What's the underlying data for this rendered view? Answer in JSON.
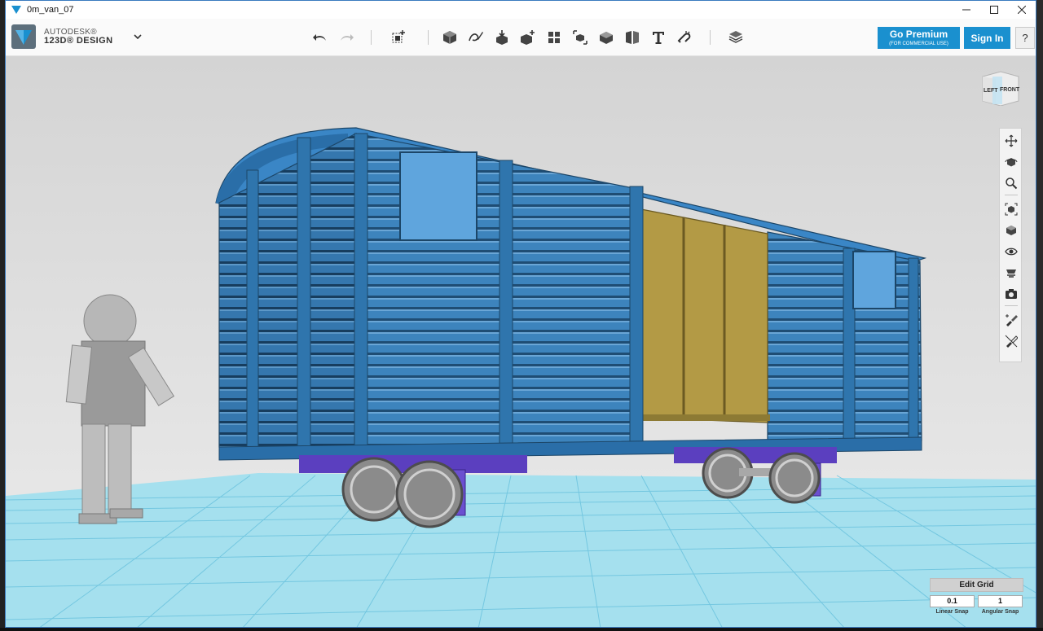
{
  "window": {
    "title": "0m_van_07"
  },
  "app": {
    "brand_line1": "AUTODESK®",
    "brand_line2": "123D® DESIGN"
  },
  "toolbar": {
    "premium_label": "Go Premium",
    "premium_sub": "(FOR COMMERCIAL USE)",
    "signin_label": "Sign In",
    "help_label": "?"
  },
  "viewcube": {
    "left_label": "LEFT",
    "front_label": "FRONT"
  },
  "grid": {
    "edit_label": "Edit Grid",
    "linear_snap_value": "0.1",
    "angular_snap_value": "1",
    "linear_snap_label": "Linear Snap",
    "angular_snap_label": "Angular Snap"
  },
  "colors": {
    "accent": "#1a90cf",
    "model_blue": "#3b7fb8",
    "door_gold": "#b39a45",
    "chassis_purple": "#5b3fbf"
  }
}
